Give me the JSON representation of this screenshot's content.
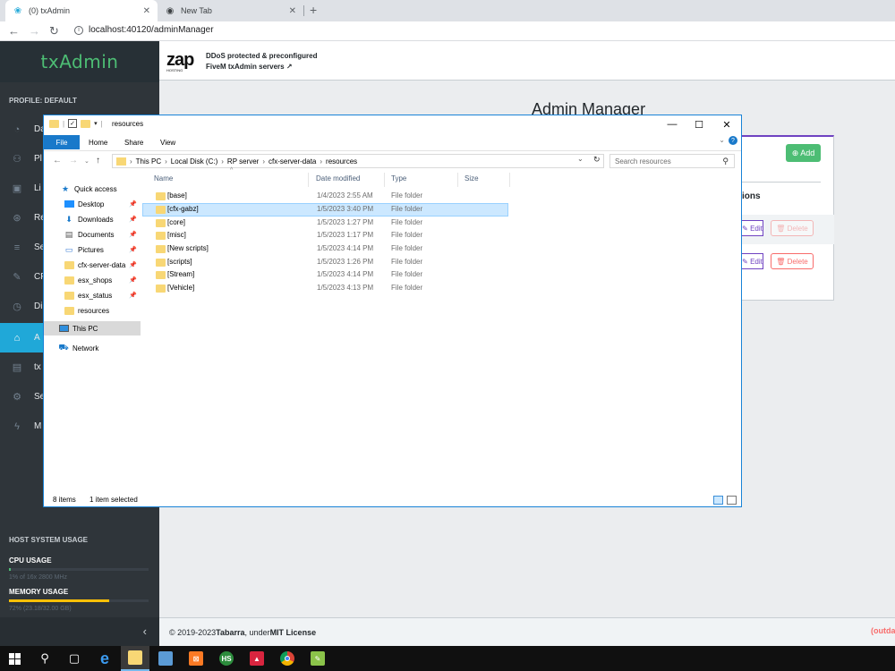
{
  "browser": {
    "tabs": [
      {
        "title": "(0) txAdmin",
        "active": true
      },
      {
        "title": "New Tab",
        "active": false
      }
    ],
    "url": "localhost:40120/adminManager"
  },
  "sidebar": {
    "brand": "txAdmin",
    "profile_label": "PROFILE: DEFAULT",
    "items": [
      {
        "label": "Da",
        "icon": "dashboard-icon"
      },
      {
        "label": "Pl",
        "icon": "players-icon"
      },
      {
        "label": "Li",
        "icon": "console-icon"
      },
      {
        "label": "Re",
        "icon": "resources-icon"
      },
      {
        "label": "Se",
        "icon": "list-icon"
      },
      {
        "label": "CF",
        "icon": "pencil-icon"
      },
      {
        "label": "Di",
        "icon": "clock-icon"
      },
      {
        "label": "A",
        "icon": "admin-icon",
        "active": true
      },
      {
        "label": "tx",
        "icon": "log-icon"
      },
      {
        "label": "Se",
        "icon": "gear-icon"
      },
      {
        "label": "M",
        "icon": "plug-icon"
      }
    ],
    "host_system_label": "HOST SYSTEM USAGE",
    "cpu": {
      "title": "CPU USAGE",
      "detail": "1% of 16x 2800 MHz",
      "percent": 1,
      "color": "#4dbd74"
    },
    "memory": {
      "title": "MEMORY USAGE",
      "detail": "72% (23.18/32.00 GB)",
      "percent": 72,
      "color": "#ffc107"
    },
    "minimize_glyph": "‹"
  },
  "header": {
    "logo_text": "zap",
    "logo_sub": "HOSTING",
    "promo_line1": "DDoS protected & preconfigured",
    "promo_line2": "FiveM txAdmin servers ↗"
  },
  "page": {
    "title": "Admin Manager",
    "add_label": "⊕ Add",
    "column_partial": "ions",
    "edit_label": "✎ Edit",
    "delete_label": "🗑 Delete"
  },
  "footer": {
    "copyright": "© 2019-2023 ",
    "author": "Tabarra",
    "under": ", under ",
    "license": "MIT License",
    "outdated": "(outda"
  },
  "explorer": {
    "title": "resources",
    "ribbon_tabs": [
      "File",
      "Home",
      "Share",
      "View"
    ],
    "path": [
      "This PC",
      "Local Disk (C:)",
      "RP server",
      "cfx-server-data",
      "resources"
    ],
    "search_placeholder": "Search resources",
    "nav": [
      {
        "label": "Quick access",
        "icon": "star-icon",
        "pinned": false
      },
      {
        "label": "Desktop",
        "icon": "desktop-icon",
        "pinned": true
      },
      {
        "label": "Downloads",
        "icon": "download-icon",
        "pinned": true
      },
      {
        "label": "Documents",
        "icon": "documents-icon",
        "pinned": true
      },
      {
        "label": "Pictures",
        "icon": "pictures-icon",
        "pinned": true
      },
      {
        "label": "cfx-server-data",
        "icon": "folder-icon",
        "pinned": true
      },
      {
        "label": "esx_shops",
        "icon": "folder-icon",
        "pinned": true
      },
      {
        "label": "esx_status",
        "icon": "folder-icon",
        "pinned": true
      },
      {
        "label": "resources",
        "icon": "folder-icon",
        "pinned": false
      },
      {
        "label": "This PC",
        "icon": "computer-icon",
        "pinned": false,
        "selected": true
      },
      {
        "label": "Network",
        "icon": "network-icon",
        "pinned": false
      }
    ],
    "columns": [
      "Name",
      "Date modified",
      "Type",
      "Size"
    ],
    "files": [
      {
        "name": "[base]",
        "date": "1/4/2023 2:55 AM",
        "type": "File folder"
      },
      {
        "name": "[cfx-gabz]",
        "date": "1/5/2023 3:40 PM",
        "type": "File folder",
        "selected": true
      },
      {
        "name": "[core]",
        "date": "1/5/2023 1:27 PM",
        "type": "File folder"
      },
      {
        "name": "[misc]",
        "date": "1/5/2023 1:17 PM",
        "type": "File folder"
      },
      {
        "name": "[New scripts]",
        "date": "1/5/2023 4:14 PM",
        "type": "File folder"
      },
      {
        "name": "[scripts]",
        "date": "1/5/2023 1:26 PM",
        "type": "File folder"
      },
      {
        "name": "[Stream]",
        "date": "1/5/2023 4:14 PM",
        "type": "File folder"
      },
      {
        "name": "[Vehicle]",
        "date": "1/5/2023 4:13 PM",
        "type": "File folder"
      }
    ],
    "status_count": "8 items",
    "status_selected": "1 item selected"
  },
  "taskbar": {
    "items": [
      {
        "name": "start-icon"
      },
      {
        "name": "search-icon"
      },
      {
        "name": "task-view-icon"
      },
      {
        "name": "edge-icon"
      },
      {
        "name": "file-explorer-icon",
        "active": true
      },
      {
        "name": "app-icon"
      },
      {
        "name": "xampp-icon"
      },
      {
        "name": "hs-icon",
        "text": "HS"
      },
      {
        "name": "app-red-icon"
      },
      {
        "name": "chrome-icon"
      },
      {
        "name": "notepadpp-icon"
      }
    ]
  }
}
